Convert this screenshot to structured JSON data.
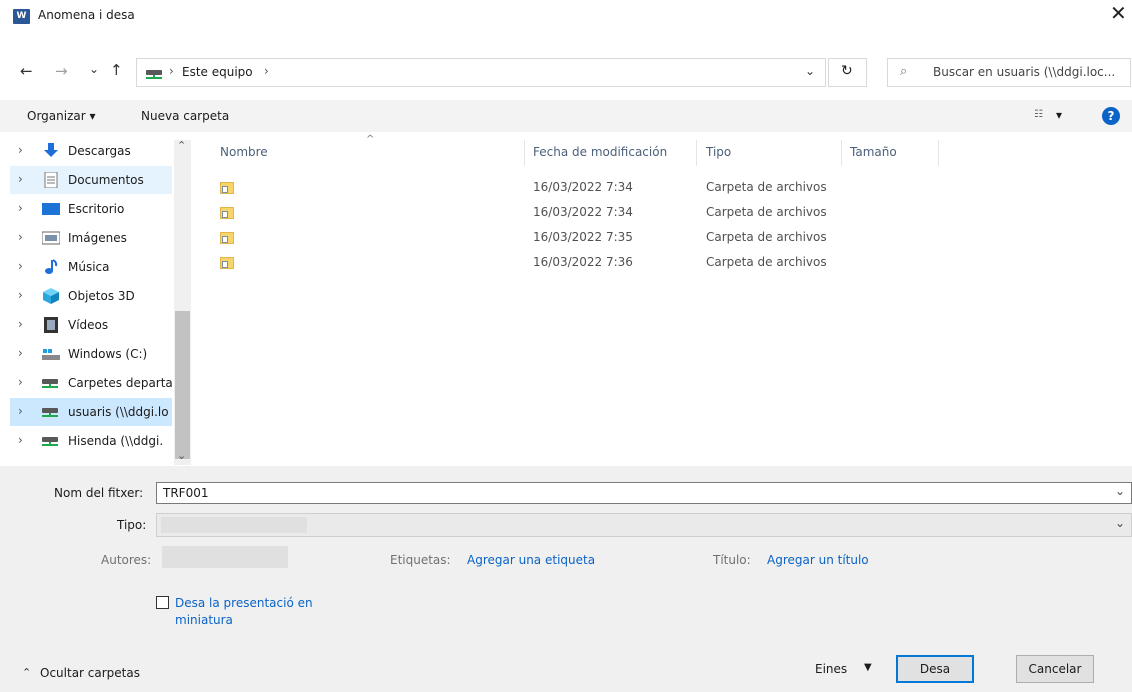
{
  "window": {
    "title": "Anomena i desa",
    "app_icon_text": "W"
  },
  "nav": {
    "back_glyph": "←",
    "forward_glyph": "→",
    "recent_glyph": "⌄",
    "up_glyph": "↑",
    "breadcrumb": [
      "Este equipo"
    ],
    "refresh_glyph": "↻",
    "search_placeholder": "Buscar en usuaris (\\\\ddgi.loc..."
  },
  "toolbar": {
    "organize_label": "Organizar ▾",
    "new_folder_label": "Nueva carpeta",
    "view_label": "▾",
    "help_label": "?"
  },
  "tree": {
    "items": [
      {
        "label": "Descargas",
        "icon": "download-icon"
      },
      {
        "label": "Documentos",
        "icon": "documents-icon"
      },
      {
        "label": "Escritorio",
        "icon": "desktop-icon"
      },
      {
        "label": "Imágenes",
        "icon": "pictures-icon"
      },
      {
        "label": "Música",
        "icon": "music-icon"
      },
      {
        "label": "Objetos 3D",
        "icon": "objects-3d-icon"
      },
      {
        "label": "Vídeos",
        "icon": "videos-icon"
      },
      {
        "label": "Windows  (C:)",
        "icon": "windows-drive-icon"
      },
      {
        "label": "Carpetes departa",
        "icon": "network-drive-icon"
      },
      {
        "label": "usuaris (\\\\ddgi.lo",
        "icon": "network-drive-icon"
      },
      {
        "label": "Hisenda (\\\\ddgi.",
        "icon": "network-drive-icon"
      }
    ]
  },
  "columns": {
    "name": "Nombre",
    "date": "Fecha de modificación",
    "type": "Tipo",
    "size": "Tamaño"
  },
  "files": [
    {
      "name": "",
      "date": "16/03/2022 7:34",
      "type": "Carpeta de archivos",
      "size": ""
    },
    {
      "name": "",
      "date": "16/03/2022 7:34",
      "type": "Carpeta de archivos",
      "size": ""
    },
    {
      "name": "",
      "date": "16/03/2022 7:35",
      "type": "Carpeta de archivos",
      "size": ""
    },
    {
      "name": "",
      "date": "16/03/2022 7:36",
      "type": "Carpeta de archivos",
      "size": ""
    }
  ],
  "form": {
    "filename_label": "Nom del fitxer:",
    "filename_value": "TRF001",
    "type_label": "Tipo:",
    "authors_label": "Autores:",
    "tags_label": "Etiquetas:",
    "tags_link": "Agregar una etiqueta",
    "title_label": "Título:",
    "title_link": "Agregar un título",
    "thumbnail_label_line1": "Desa la presentació en",
    "thumbnail_label_line2": "miniatura"
  },
  "footer": {
    "hide_folders": "Ocultar carpetas",
    "tools_label": "Eines",
    "save_label": "Desa",
    "cancel_label": "Cancelar"
  }
}
